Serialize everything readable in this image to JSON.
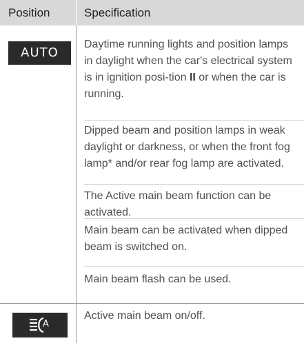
{
  "table": {
    "headers": {
      "position": "Position",
      "specification": "Specification"
    },
    "rows": [
      {
        "position_badge": "AUTO",
        "specs": [
          {
            "parts": [
              "Daytime running lights and position lamps in daylight when the car's electrical system is in ignition posi-tion ",
              "II",
              " or when the car is running."
            ]
          },
          {
            "text": "Dipped beam and position lamps in weak daylight or darkness, or when the front fog lamp* and/or rear fog lamp are activated."
          },
          {
            "text": "The Active main beam function can be activated."
          },
          {
            "text": "Main beam can be activated when dipped beam is switched on."
          },
          {
            "text": "Main beam flash can be used."
          }
        ]
      },
      {
        "position_badge": "",
        "position_icon": "active-main-beam-icon",
        "specs": [
          {
            "text": "Active main beam on/off."
          }
        ]
      }
    ]
  }
}
